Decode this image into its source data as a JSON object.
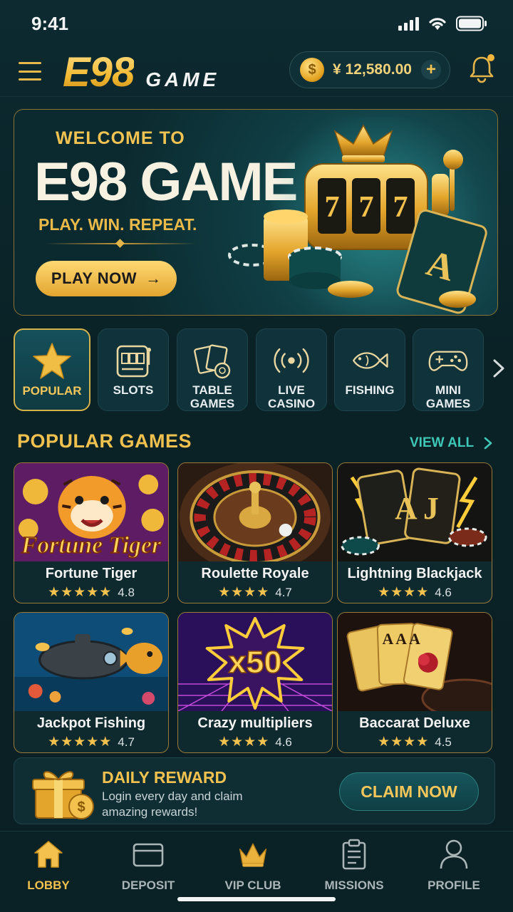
{
  "status_bar": {
    "time": "9:41"
  },
  "header": {
    "brand_main": "E98",
    "brand_sub": "GAME",
    "balance": "¥ 12,580.00",
    "coin_symbol": "$",
    "add_symbol": "+"
  },
  "banner": {
    "welcome": "WELCOME TO",
    "title": "E98 GAME",
    "tagline": "PLAY. WIN. REPEAT.",
    "cta": "PLAY NOW",
    "cta_arrow": "→",
    "slot_digits": [
      "7",
      "7",
      "7"
    ],
    "card_rank": "A"
  },
  "categories": [
    {
      "label": "POPULAR",
      "icon": "star-icon",
      "active": true
    },
    {
      "label": "SLOTS",
      "icon": "slot-machine-icon"
    },
    {
      "label": "TABLE\nGAMES",
      "icon": "cards-icon"
    },
    {
      "label": "LIVE\nCASINO",
      "icon": "broadcast-icon"
    },
    {
      "label": "FISHING",
      "icon": "fish-icon"
    },
    {
      "label": "MINI\nGAMES",
      "icon": "gamepad-icon"
    }
  ],
  "popular": {
    "title": "POPULAR GAMES",
    "view_all": "VIEW ALL",
    "games": [
      {
        "title": "Fortune Tiger",
        "rating": "4.8",
        "stars": "★★★★★",
        "art_text": "Fortune Tiger"
      },
      {
        "title": "Roulette Royale",
        "rating": "4.7",
        "stars": "★★★★"
      },
      {
        "title": "Lightning Blackjack",
        "rating": "4.6",
        "stars": "★★★★",
        "art_text": "A  J"
      },
      {
        "title": "Jackpot Fishing",
        "rating": "4.7",
        "stars": "★★★★★"
      },
      {
        "title": "Crazy multipliers",
        "rating": "4.6",
        "stars": "★★★★",
        "art_text": "x50"
      },
      {
        "title": "Baccarat Deluxe",
        "rating": "4.5",
        "stars": "★★★★",
        "art_text": "A A A"
      }
    ]
  },
  "reward": {
    "title": "DAILY REWARD",
    "description": "Login every day and claim amazing rewards!",
    "cta": "CLAIM NOW",
    "coin_symbol": "$"
  },
  "nav": [
    {
      "label": "LOBBY",
      "icon": "home-icon",
      "active": true
    },
    {
      "label": "DEPOSIT",
      "icon": "card-icon"
    },
    {
      "label": "VIP CLUB",
      "icon": "crown-icon"
    },
    {
      "label": "MISSIONS",
      "icon": "clipboard-icon"
    },
    {
      "label": "PROFILE",
      "icon": "user-icon"
    }
  ],
  "colors": {
    "background": "#0b2227",
    "gold": "#f0c14f",
    "teal_accent": "#3ec7b7"
  }
}
